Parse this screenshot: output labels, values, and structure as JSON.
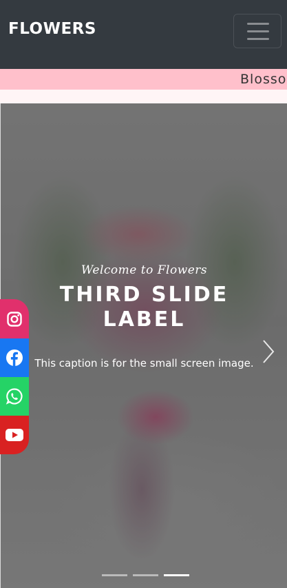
{
  "navbar": {
    "brand": "FLOWERS",
    "toggler_icon": "hamburger-menu-icon"
  },
  "marquee": {
    "text": "Blossoms"
  },
  "carousel": {
    "eyebrow": "Welcome to Flowers",
    "title": "Third Slide Label",
    "text": "This caption is for the small screen image.",
    "next_icon": "chevron-right-icon",
    "indicators": [
      {
        "active": false
      },
      {
        "active": false
      },
      {
        "active": true
      }
    ]
  },
  "social": {
    "items": [
      {
        "name": "instagram",
        "icon": "instagram-icon",
        "color": "#e1306c"
      },
      {
        "name": "facebook",
        "icon": "facebook-icon",
        "color": "#1877f2"
      },
      {
        "name": "whatsapp",
        "icon": "whatsapp-icon",
        "color": "#25d366"
      },
      {
        "name": "youtube",
        "icon": "youtube-icon",
        "color": "#d92121"
      }
    ]
  },
  "colors": {
    "navbar_bg": "#343a40",
    "marquee_bg": "#ffc0cb"
  }
}
